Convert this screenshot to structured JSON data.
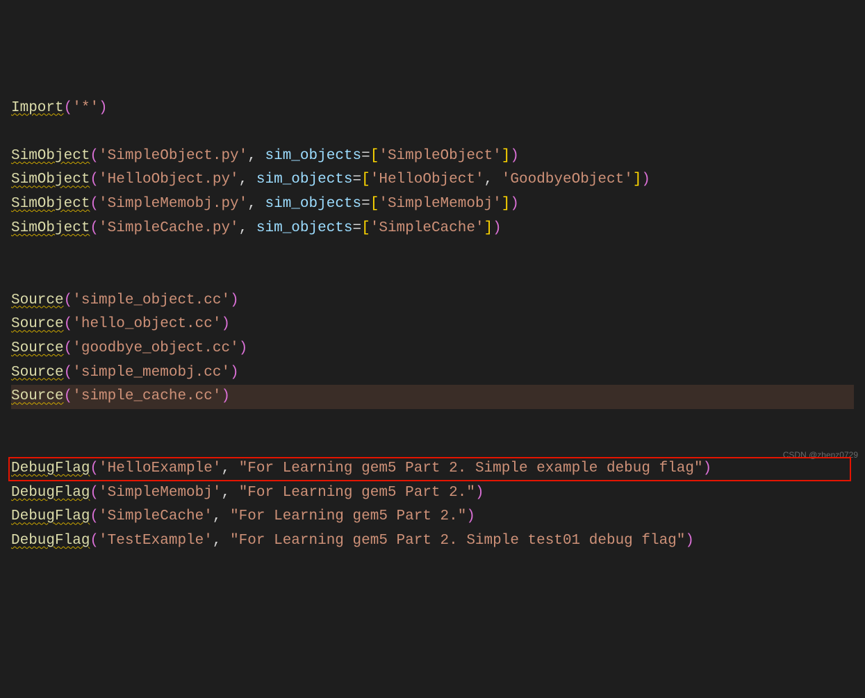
{
  "lines": [
    {
      "tokens": [
        {
          "t": "func",
          "v": "Import"
        },
        {
          "t": "paren",
          "v": "("
        },
        {
          "t": "str",
          "v": "'*'"
        },
        {
          "t": "paren",
          "v": ")"
        }
      ]
    },
    {
      "tokens": []
    },
    {
      "tokens": [
        {
          "t": "func",
          "v": "SimObject"
        },
        {
          "t": "paren",
          "v": "("
        },
        {
          "t": "str",
          "v": "'SimpleObject.py'"
        },
        {
          "t": "op",
          "v": ", "
        },
        {
          "t": "kwarg",
          "v": "sim_objects"
        },
        {
          "t": "op",
          "v": "="
        },
        {
          "t": "bracket",
          "v": "["
        },
        {
          "t": "str",
          "v": "'SimpleObject'"
        },
        {
          "t": "bracket",
          "v": "]"
        },
        {
          "t": "paren",
          "v": ")"
        }
      ]
    },
    {
      "tokens": [
        {
          "t": "func",
          "v": "SimObject"
        },
        {
          "t": "paren",
          "v": "("
        },
        {
          "t": "str",
          "v": "'HelloObject.py'"
        },
        {
          "t": "op",
          "v": ", "
        },
        {
          "t": "kwarg",
          "v": "sim_objects"
        },
        {
          "t": "op",
          "v": "="
        },
        {
          "t": "bracket",
          "v": "["
        },
        {
          "t": "str",
          "v": "'HelloObject'"
        },
        {
          "t": "op",
          "v": ", "
        },
        {
          "t": "str",
          "v": "'GoodbyeObject'"
        },
        {
          "t": "bracket",
          "v": "]"
        },
        {
          "t": "paren",
          "v": ")"
        }
      ]
    },
    {
      "tokens": [
        {
          "t": "func",
          "v": "SimObject"
        },
        {
          "t": "paren",
          "v": "("
        },
        {
          "t": "str",
          "v": "'SimpleMemobj.py'"
        },
        {
          "t": "op",
          "v": ", "
        },
        {
          "t": "kwarg",
          "v": "sim_objects"
        },
        {
          "t": "op",
          "v": "="
        },
        {
          "t": "bracket",
          "v": "["
        },
        {
          "t": "str",
          "v": "'SimpleMemobj'"
        },
        {
          "t": "bracket",
          "v": "]"
        },
        {
          "t": "paren",
          "v": ")"
        }
      ]
    },
    {
      "tokens": [
        {
          "t": "func",
          "v": "SimObject"
        },
        {
          "t": "paren",
          "v": "("
        },
        {
          "t": "str",
          "v": "'SimpleCache.py'"
        },
        {
          "t": "op",
          "v": ", "
        },
        {
          "t": "kwarg",
          "v": "sim_objects"
        },
        {
          "t": "op",
          "v": "="
        },
        {
          "t": "bracket",
          "v": "["
        },
        {
          "t": "str",
          "v": "'SimpleCache'"
        },
        {
          "t": "bracket",
          "v": "]"
        },
        {
          "t": "paren",
          "v": ")"
        }
      ]
    },
    {
      "tokens": []
    },
    {
      "tokens": []
    },
    {
      "tokens": [
        {
          "t": "func",
          "v": "Source"
        },
        {
          "t": "paren",
          "v": "("
        },
        {
          "t": "str",
          "v": "'simple_object.cc'"
        },
        {
          "t": "paren",
          "v": ")"
        }
      ]
    },
    {
      "tokens": [
        {
          "t": "func",
          "v": "Source"
        },
        {
          "t": "paren",
          "v": "("
        },
        {
          "t": "str",
          "v": "'hello_object.cc'"
        },
        {
          "t": "paren",
          "v": ")"
        }
      ]
    },
    {
      "tokens": [
        {
          "t": "func",
          "v": "Source"
        },
        {
          "t": "paren",
          "v": "("
        },
        {
          "t": "str",
          "v": "'goodbye_object.cc'"
        },
        {
          "t": "paren",
          "v": ")"
        }
      ]
    },
    {
      "tokens": [
        {
          "t": "func",
          "v": "Source"
        },
        {
          "t": "paren",
          "v": "("
        },
        {
          "t": "str",
          "v": "'simple_memobj.cc'"
        },
        {
          "t": "paren",
          "v": ")"
        }
      ]
    },
    {
      "highlight": true,
      "tokens": [
        {
          "t": "func",
          "v": "Source"
        },
        {
          "t": "paren",
          "v": "("
        },
        {
          "t": "str",
          "v": "'simple_cache.cc'"
        },
        {
          "t": "paren",
          "v": ")"
        }
      ]
    },
    {
      "tokens": []
    },
    {
      "tokens": []
    },
    {
      "boxed": true,
      "tokens": [
        {
          "t": "func",
          "v": "DebugFlag"
        },
        {
          "t": "paren",
          "v": "("
        },
        {
          "t": "str",
          "v": "'HelloExample'"
        },
        {
          "t": "op",
          "v": ", "
        },
        {
          "t": "str",
          "v": "\"For Learning gem5 Part 2. Simple example debug flag\""
        },
        {
          "t": "paren",
          "v": ")"
        }
      ]
    },
    {
      "tokens": [
        {
          "t": "func",
          "v": "DebugFlag"
        },
        {
          "t": "paren",
          "v": "("
        },
        {
          "t": "str",
          "v": "'SimpleMemobj'"
        },
        {
          "t": "op",
          "v": ", "
        },
        {
          "t": "str",
          "v": "\"For Learning gem5 Part 2.\""
        },
        {
          "t": "paren",
          "v": ")"
        }
      ]
    },
    {
      "tokens": [
        {
          "t": "func",
          "v": "DebugFlag"
        },
        {
          "t": "paren",
          "v": "("
        },
        {
          "t": "str",
          "v": "'SimpleCache'"
        },
        {
          "t": "op",
          "v": ", "
        },
        {
          "t": "str",
          "v": "\"For Learning gem5 Part 2.\""
        },
        {
          "t": "paren",
          "v": ")"
        }
      ]
    },
    {
      "tokens": [
        {
          "t": "func",
          "v": "DebugFlag"
        },
        {
          "t": "paren",
          "v": "("
        },
        {
          "t": "str",
          "v": "'TestExample'"
        },
        {
          "t": "op",
          "v": ", "
        },
        {
          "t": "str",
          "v": "\"For Learning gem5 Part 2. Simple test01 debug flag\""
        },
        {
          "t": "paren",
          "v": ")"
        }
      ]
    }
  ],
  "watermark": "CSDN @zhenz0729"
}
